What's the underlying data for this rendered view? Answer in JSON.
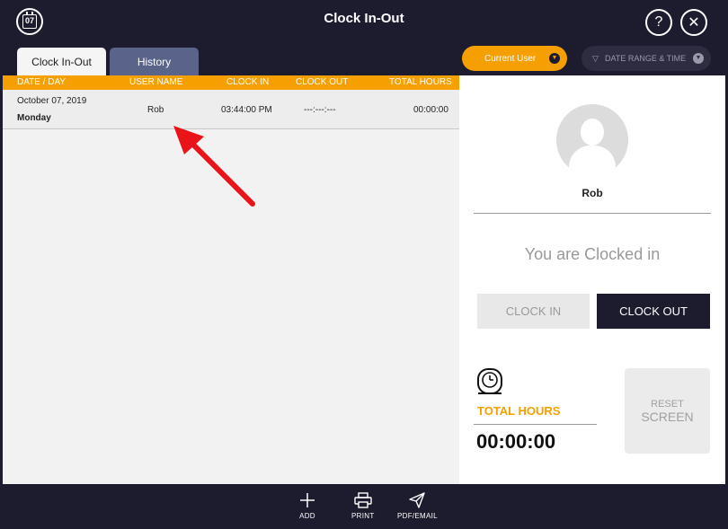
{
  "header": {
    "title": "Clock In-Out",
    "calendar_day": "07",
    "help_label": "?",
    "close_label": "✕"
  },
  "tabs": [
    {
      "label": "Clock In-Out",
      "active": true
    },
    {
      "label": "History",
      "active": false
    }
  ],
  "filters": {
    "current_user": "Current User",
    "date_range": "DATE RANGE & TIME"
  },
  "table": {
    "columns": [
      "DATE / DAY",
      "USER NAME",
      "CLOCK IN",
      "CLOCK OUT",
      "TOTAL HOURS"
    ],
    "rows": [
      {
        "date": "October 07, 2019",
        "day": "Monday",
        "user": "Rob",
        "clock_in": "03:44:00 PM",
        "clock_out": "---:---:---",
        "total": "00:00:00"
      }
    ]
  },
  "user_panel": {
    "name": "Rob",
    "status": "You are Clocked in",
    "clock_in_label": "CLOCK IN",
    "clock_out_label": "CLOCK OUT",
    "total_hours_label": "TOTAL HOURS",
    "total_hours_value": "00:00:00",
    "reset_line1": "RESET",
    "reset_line2": "SCREEN"
  },
  "footer": {
    "add_label": "ADD",
    "print_label": "PRINT",
    "pdf_label": "PDF/EMAIL"
  },
  "colors": {
    "accent": "#f5a000",
    "dark": "#1d1b2e",
    "history_tab": "#5a6389",
    "annotation_arrow": "#e8141a"
  }
}
